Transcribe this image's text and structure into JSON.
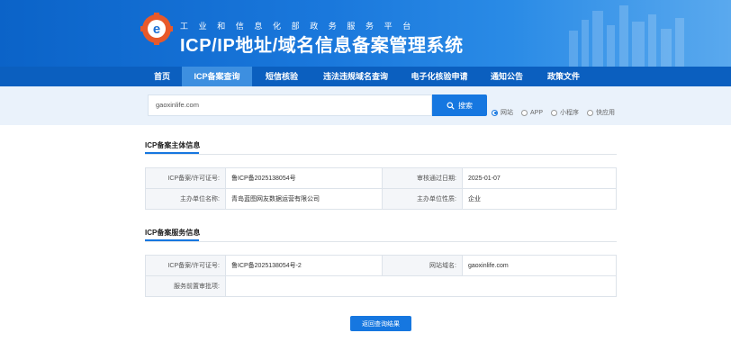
{
  "header": {
    "subtitle": "工业和信息化部政务服务平台",
    "title": "ICP/IP地址/域名信息备案管理系统"
  },
  "nav": {
    "items": [
      {
        "label": "首页",
        "width": 44
      },
      {
        "label": "ICP备案查询",
        "width": 78,
        "active": true
      },
      {
        "label": "短信核验",
        "width": 66
      },
      {
        "label": "违法违规域名查询",
        "width": 98
      },
      {
        "label": "电子化核验申请",
        "width": 88
      },
      {
        "label": "通知公告",
        "width": 62
      },
      {
        "label": "政策文件",
        "width": 64
      }
    ]
  },
  "search": {
    "value": "gaoxinlife.com",
    "button_label": "搜索",
    "types": [
      {
        "label": "网站",
        "selected": true
      },
      {
        "label": "APP",
        "selected": false
      },
      {
        "label": "小程序",
        "selected": false
      },
      {
        "label": "快应用",
        "selected": false
      }
    ]
  },
  "subject_section": {
    "title": "ICP备案主体信息",
    "rows": [
      {
        "l1": "ICP备案/许可证号:",
        "v1": "鲁ICP备2025138054号",
        "l2": "审核通过日期:",
        "v2": "2025-01-07"
      },
      {
        "l1": "主办单位名称:",
        "v1": "青岛蓝图网友数据运营有限公司",
        "l2": "主办单位性质:",
        "v2": "企业"
      }
    ]
  },
  "service_section": {
    "title": "ICP备案服务信息",
    "row1": {
      "l1": "ICP备案/许可证号:",
      "v1": "鲁ICP备2025138054号-2",
      "l2": "网站域名:",
      "v2": "gaoxinlife.com"
    },
    "row2": {
      "l1": "服务前置审批项:",
      "v1": ""
    }
  },
  "back_button": "返回查询结果"
}
